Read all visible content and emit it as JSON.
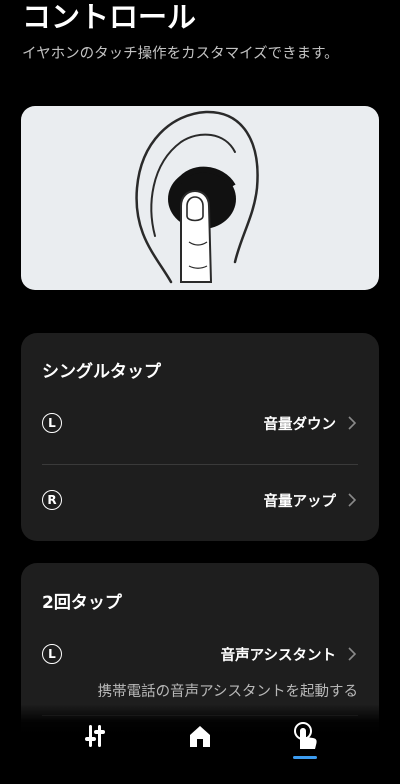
{
  "header": {
    "title": "コントロール",
    "subtitle": "イヤホンのタッチ操作をカスタマイズできます。"
  },
  "illustration": {
    "icon": "ear-touch-illustration"
  },
  "single_tap": {
    "title": "シングルタップ",
    "rows": [
      {
        "side": "L",
        "value": "音量ダウン"
      },
      {
        "side": "R",
        "value": "音量アップ"
      }
    ]
  },
  "double_tap": {
    "title": "2回タップ",
    "rows": [
      {
        "side": "L",
        "value": "音声アシスタント",
        "description": "携帯電話の音声アシスタントを起動する"
      }
    ]
  },
  "tabbar": {
    "tabs": [
      {
        "icon": "equalizer-icon"
      },
      {
        "icon": "home-icon"
      },
      {
        "icon": "touch-icon",
        "selected": true
      }
    ],
    "accent": "#3c9cf0"
  }
}
